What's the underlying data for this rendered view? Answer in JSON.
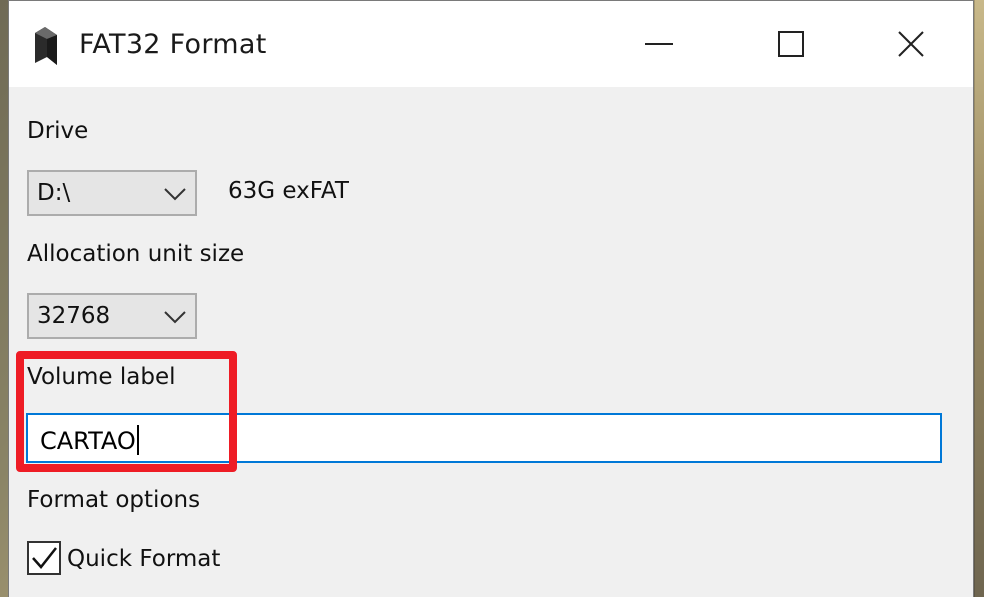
{
  "window": {
    "title": "FAT32 Format"
  },
  "drive": {
    "label": "Drive",
    "selected": "D:\\",
    "info": "63G exFAT"
  },
  "allocation": {
    "label": "Allocation unit size",
    "selected": "32768"
  },
  "volume": {
    "label": "Volume label",
    "value": "CARTAO"
  },
  "options": {
    "label": "Format options",
    "quick_format_label": "Quick Format",
    "quick_format_checked": true
  },
  "colors": {
    "highlight": "#ee1c25",
    "input_focus_border": "#0078d7"
  },
  "icons": [
    "app-icon",
    "minimize-icon",
    "maximize-icon",
    "close-icon",
    "chevron-down-icon",
    "checkmark-icon"
  ]
}
